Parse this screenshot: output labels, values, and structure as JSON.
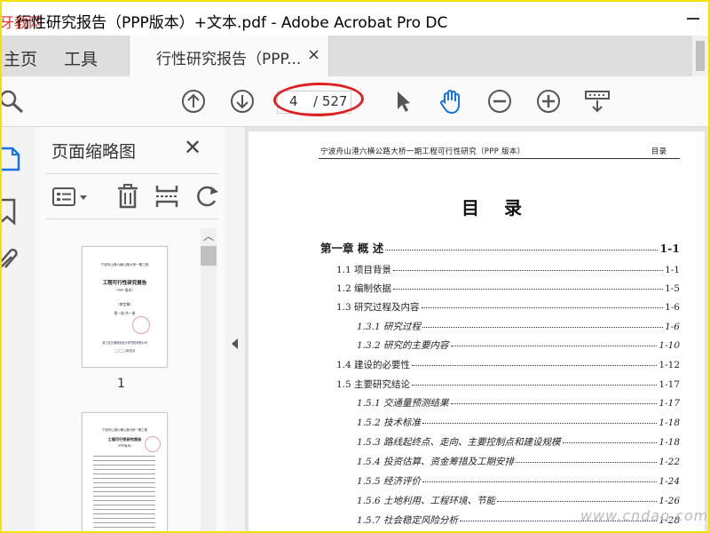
{
  "window": {
    "title": "行性研究报告（PPP版本）+文本.pdf - Adobe Acrobat Pro DC",
    "logo_overlay": "牙教网"
  },
  "tabs": {
    "home_label": "主页",
    "tools_label": "工具",
    "doc_label": "行性研究报告（PPP...",
    "close_glyph": "×"
  },
  "toolbar": {
    "current_page": "4",
    "total_pages": "/ 527",
    "icons": [
      "search-icon",
      "page-up-icon",
      "page-down-icon",
      "select-arrow-icon",
      "hand-tool-icon",
      "zoom-out-icon",
      "zoom-in-icon",
      "scroll-mode-icon"
    ],
    "highlight_color": "#e02020",
    "accent_color": "#1473e6"
  },
  "left_rail": {
    "icons": [
      "page-thumbnails-icon",
      "bookmark-icon",
      "attachment-icon"
    ]
  },
  "thumbnails_panel": {
    "title": "页面缩略图",
    "close_glyph": "✕",
    "tools": [
      "options-menu-icon",
      "delete-icon",
      "extract-icon",
      "rotate-icon"
    ],
    "pages": [
      {
        "number": "1",
        "lines": [
          "宁波舟山港六横公路大桥一期工程",
          "工程可行性研究报告",
          "（PPP 版本）",
          "（审定稿）",
          "第一册  共一册",
          "浙江省交通规划设计研究院有限公司",
          "二○二○年四月"
        ]
      },
      {
        "number": "",
        "lines": [
          "宁波舟山港六横公路大桥一期工程",
          "工程可行性研究报告",
          "（PPP版本）"
        ]
      }
    ]
  },
  "document": {
    "header_left": "宁波舟山港六横公路大桥一期工程可行性研究（PPP 版本）",
    "header_right": "目录",
    "toc_title": "目录",
    "toc": [
      {
        "level": 0,
        "text": "第一章    概  述",
        "page": "1-1"
      },
      {
        "level": 1,
        "text": "1.1 项目背景",
        "page": "1-1"
      },
      {
        "level": 1,
        "text": "1.2 编制依据",
        "page": "1-5"
      },
      {
        "level": 1,
        "text": "1.3 研究过程及内容",
        "page": "1-6"
      },
      {
        "level": 2,
        "text": "1.3.1  研究过程",
        "page": "1-6"
      },
      {
        "level": 2,
        "text": "1.3.2  研究的主要内容",
        "page": "1-10"
      },
      {
        "level": 1,
        "text": "1.4 建设的必要性",
        "page": "1-12"
      },
      {
        "level": 1,
        "text": "1.5 主要研究结论",
        "page": "1-17"
      },
      {
        "level": 2,
        "text": "1.5.1  交通量预测结果",
        "page": "1-17"
      },
      {
        "level": 2,
        "text": "1.5.2  技术标准",
        "page": "1-18"
      },
      {
        "level": 2,
        "text": "1.5.3  路线起终点、走向、主要控制点和建设规模",
        "page": "1-18"
      },
      {
        "level": 2,
        "text": "1.5.4  投资估算、资金筹措及工期安排",
        "page": "1-22"
      },
      {
        "level": 2,
        "text": "1.5.5  经济评价",
        "page": "1-24"
      },
      {
        "level": 2,
        "text": "1.5.6  土地利用、工程环境、节能",
        "page": "1-26"
      },
      {
        "level": 2,
        "text": "1.5.7  社会稳定风险分析",
        "page": "1-28"
      }
    ]
  },
  "watermark": {
    "text": "www.cndao.com"
  }
}
